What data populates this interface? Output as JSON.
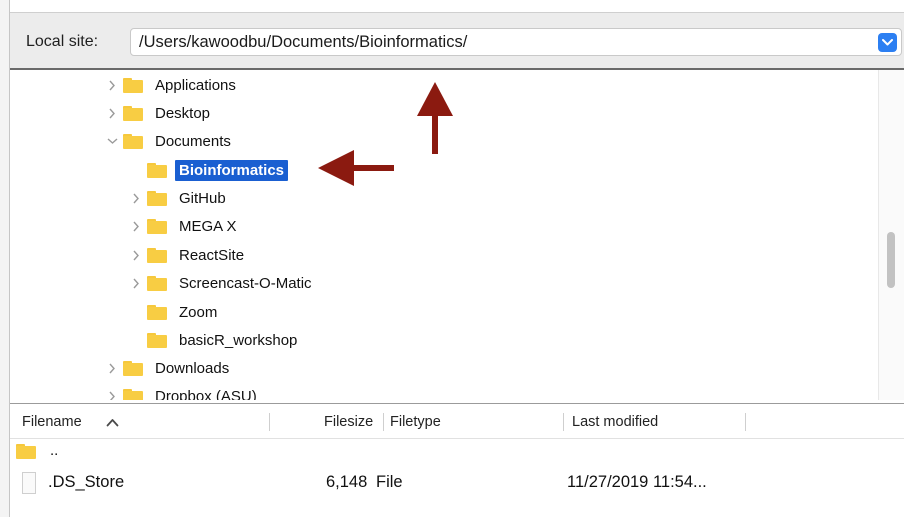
{
  "site_bar": {
    "label": "Local site:",
    "path": "/Users/kawoodbu/Documents/Bioinformatics/"
  },
  "tree": {
    "items": [
      {
        "label": "Applications",
        "expander": "collapsed"
      },
      {
        "label": "Desktop",
        "expander": "collapsed"
      },
      {
        "label": "Documents",
        "expander": "expanded"
      },
      {
        "label": "Bioinformatics",
        "expander": "none",
        "selected": true
      },
      {
        "label": "GitHub",
        "expander": "collapsed"
      },
      {
        "label": "MEGA X",
        "expander": "collapsed"
      },
      {
        "label": "ReactSite",
        "expander": "collapsed"
      },
      {
        "label": "Screencast-O-Matic",
        "expander": "collapsed"
      },
      {
        "label": "Zoom",
        "expander": "none"
      },
      {
        "label": "basicR_workshop",
        "expander": "none"
      },
      {
        "label": "Downloads",
        "expander": "collapsed"
      },
      {
        "label": "Dropbox (ASU)",
        "expander": "collapsed"
      }
    ]
  },
  "list": {
    "headers": {
      "filename": "Filename",
      "filesize": "Filesize",
      "filetype": "Filetype",
      "last_modified": "Last modified"
    },
    "sort_indicator": "sort-ascending-icon",
    "rows": [
      {
        "name": "..",
        "size": "",
        "type": "",
        "modified": "",
        "icon": "folder-icon"
      },
      {
        "name": ".DS_Store",
        "size": "6,148",
        "type": "File",
        "modified": "11/27/2019 11:54...",
        "icon": "file-icon"
      }
    ]
  },
  "colors": {
    "selection": "#1a5fd1",
    "folder": "#f8cd43",
    "annotation_arrow": "#8b1a10",
    "dropdown_accent": "#2c7ff2"
  }
}
